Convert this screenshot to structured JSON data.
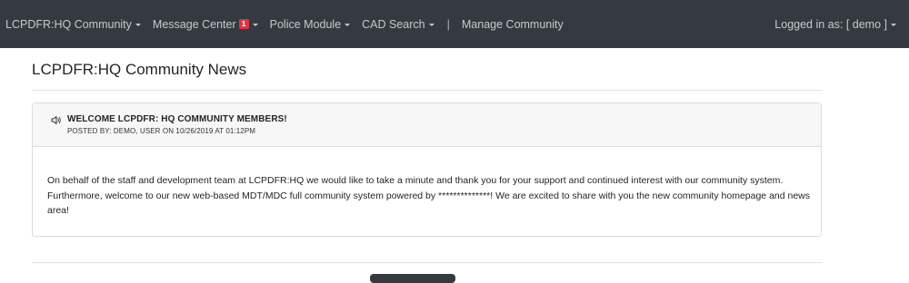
{
  "navbar": {
    "brand_menu": "LCPDFR:HQ Community",
    "message_center": "Message Center",
    "message_badge": "1",
    "police_module": "Police Module",
    "cad_search": "CAD Search",
    "separator": "|",
    "manage_community": "Manage Community",
    "logged_in": "Logged in as: [ demo ]"
  },
  "page": {
    "title": "LCPDFR:HQ Community News"
  },
  "post": {
    "icon": "speaker-icon",
    "title": "WELCOME LCPDFR: HQ COMMUNITY MEMBERS!",
    "meta": "POSTED BY: DEMO, USER ON 10/26/2019 AT 01:12PM",
    "body": "On behalf of the staff and development team at LCPDFR:HQ we would like to take a minute and thank you for your support and continued interest with our community system.  Furthermore, welcome to our new web-based MDT/MDC full community system powered by **************! We are excited to share with you the new community homepage and news area!"
  },
  "colors": {
    "navbar_bg": "#343a40",
    "badge_bg": "#dc3545",
    "card_header_bg": "#f7f7f7"
  }
}
